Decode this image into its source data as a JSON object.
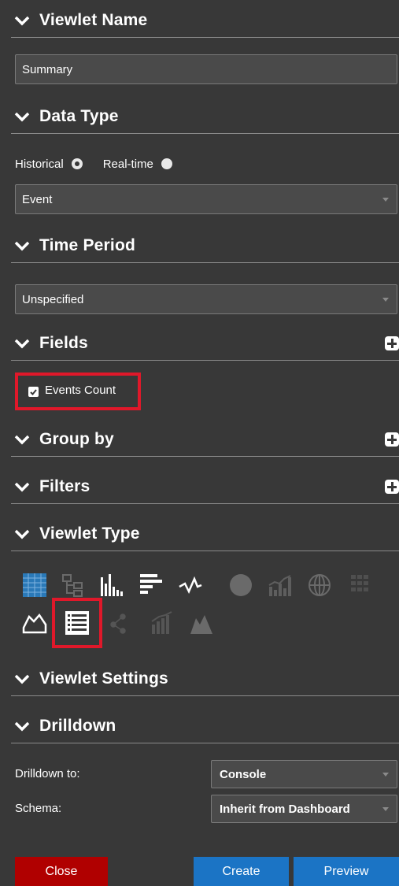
{
  "sections": {
    "viewlet_name": "Viewlet Name",
    "data_type": "Data Type",
    "time_period": "Time Period",
    "fields": "Fields",
    "group_by": "Group by",
    "filters": "Filters",
    "viewlet_type": "Viewlet Type",
    "viewlet_settings": "Viewlet Settings",
    "drilldown": "Drilldown"
  },
  "viewlet_name_value": "Summary",
  "data_type": {
    "historical_label": "Historical",
    "realtime_label": "Real-time",
    "selected": "Historical",
    "select_value": "Event"
  },
  "time_period_value": "Unspecified",
  "fields_list": {
    "events_count_label": "Events Count",
    "events_count_checked": true
  },
  "viewlet_types": [
    "table-icon",
    "tree-icon",
    "bar-chart-icon",
    "horizontal-bar-icon",
    "line-chart-icon",
    "pie-chart-icon",
    "combo-chart-icon",
    "globe-icon",
    "grid-icon",
    "area-chart-icon",
    "list-icon",
    "scatter-icon",
    "stacked-bar-icon",
    "mountain-icon"
  ],
  "viewlet_type_selected": "list-icon",
  "drilldown": {
    "drilldown_to_label": "Drilldown to:",
    "drilldown_to_value": "Console",
    "schema_label": "Schema:",
    "schema_value": "Inherit from Dashboard"
  },
  "buttons": {
    "close": "Close",
    "create": "Create",
    "preview": "Preview"
  },
  "colors": {
    "panel_bg": "#383838",
    "highlight": "#e0182a",
    "primary_button": "#1b74c5",
    "danger_button": "#b00000"
  }
}
